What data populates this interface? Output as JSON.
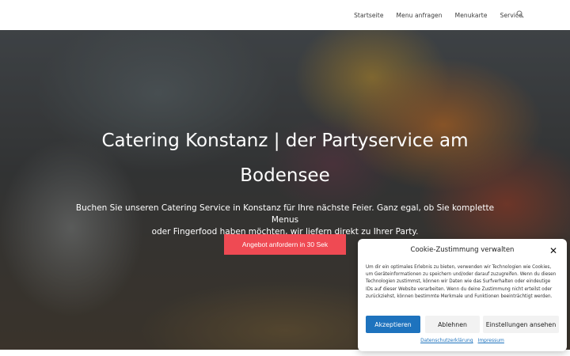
{
  "nav": {
    "items": [
      "Startseite",
      "Menu anfragen",
      "Menukarte",
      "Service"
    ],
    "search_icon": "search-icon"
  },
  "hero": {
    "title_line1": "Catering Konstanz | der Partyservice am",
    "title_line2": "Bodensee",
    "text_line1": "Buchen Sie unseren Catering Service in Konstanz für Ihre nächste Feier. Ganz egal, ob Sie komplette Menus",
    "text_line2": "oder Fingerfood haben möchten, wir liefern direkt zu Ihrer Party.",
    "cta_label": "Angebot anfordern in 30 Sek"
  },
  "cookie": {
    "title": "Cookie-Zustimmung verwalten",
    "close_icon": "close-icon",
    "text": "Um dir ein optimales Erlebnis zu bieten, verwenden wir Technologien wie Cookies, um Geräteinformationen zu speichern und/oder darauf zuzugreifen. Wenn du diesen Technologien zustimmst, können wir Daten wie das Surfverhalten oder eindeutige IDs auf dieser Website verarbeiten. Wenn du deine Zustimmung nicht erteilst oder zurückziehst, können bestimmte Merkmale und Funktionen beeinträchtigt werden.",
    "accept_label": "Akzeptieren",
    "deny_label": "Ablehnen",
    "settings_label": "Einstellungen ansehen",
    "privacy_link": "Datenschutzerklärung",
    "imprint_link": "Impressum"
  },
  "colors": {
    "cta": "#ef4a53",
    "accept": "#1e73be",
    "link": "#1e73be"
  }
}
